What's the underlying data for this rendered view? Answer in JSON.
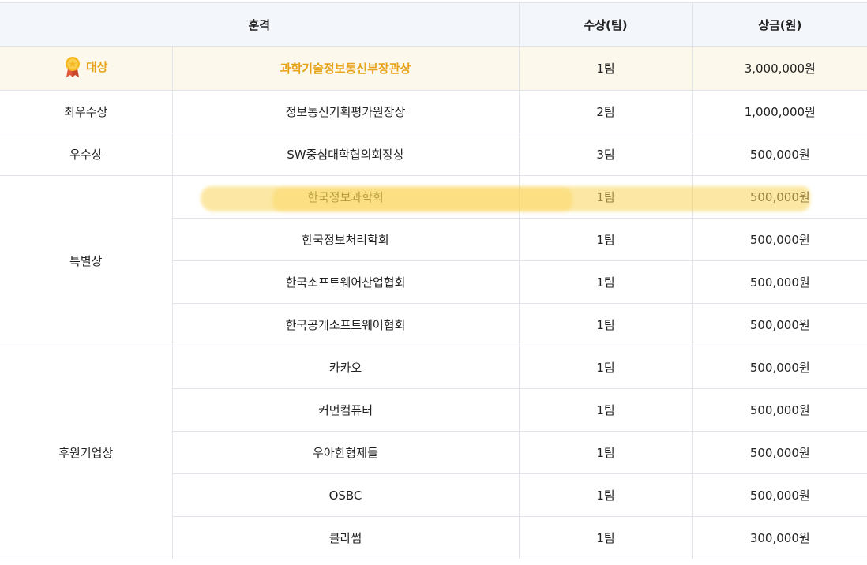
{
  "header": {
    "award": "훈격",
    "teams": "수상(팀)",
    "prize": "상금(원)"
  },
  "grand": {
    "category": "대상",
    "award": "과학기술정보통신부장관상",
    "teams": "1팀",
    "prize": "3,000,000원",
    "icon": "medal-icon",
    "accent": "#e8a21a"
  },
  "rows": [
    {
      "category": "최우수상",
      "award": "정보통신기획평가원장상",
      "teams": "2팀",
      "prize": "1,000,000원"
    },
    {
      "category": "우수상",
      "award": "SW중심대학협의회장상",
      "teams": "3팀",
      "prize": "500,000원"
    }
  ],
  "special": {
    "category": "특별상",
    "items": [
      {
        "award": "한국정보과학회",
        "teams": "1팀",
        "prize": "500,000원"
      },
      {
        "award": "한국정보처리학회",
        "teams": "1팀",
        "prize": "500,000원"
      },
      {
        "award": "한국소프트웨어산업협회",
        "teams": "1팀",
        "prize": "500,000원"
      },
      {
        "award": "한국공개소프트웨어협회",
        "teams": "1팀",
        "prize": "500,000원"
      }
    ]
  },
  "sponsor": {
    "category": "후원기업상",
    "items": [
      {
        "award": "카카오",
        "teams": "1팀",
        "prize": "500,000원"
      },
      {
        "award": "커먼컴퓨터",
        "teams": "1팀",
        "prize": "500,000원"
      },
      {
        "award": "우아한형제들",
        "teams": "1팀",
        "prize": "500,000원"
      },
      {
        "award": "OSBC",
        "teams": "1팀",
        "prize": "500,000원"
      },
      {
        "award": "클라썸",
        "teams": "1팀",
        "prize": "300,000원"
      }
    ]
  },
  "highlight_color": "#fad65a"
}
